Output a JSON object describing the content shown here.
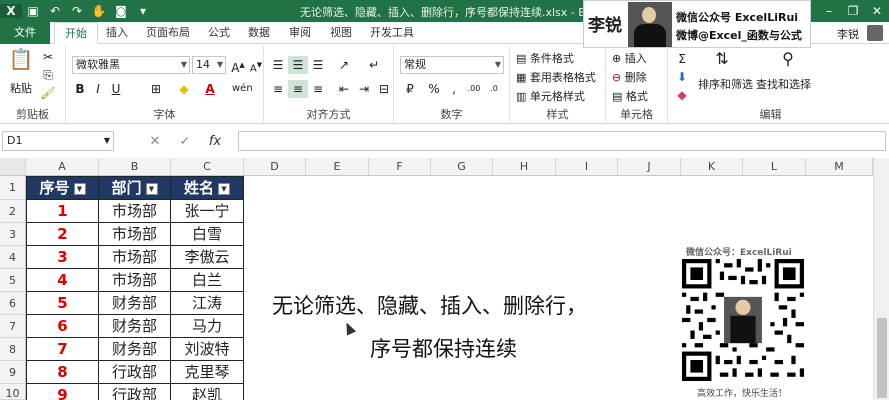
{
  "window": {
    "title": "无论筛选、隐藏、插入、删除行，序号都保持连续.xlsx - Excel"
  },
  "banner": {
    "name": "李锐",
    "line1": "微信公众号 ExcelLiRui",
    "line2": "微博@Excel_函数与公式"
  },
  "tabs": [
    "文件",
    "开始",
    "插入",
    "页面布局",
    "公式",
    "数据",
    "审阅",
    "视图",
    "开发工具"
  ],
  "user": "李锐",
  "ribbon": {
    "clipboard": {
      "label": "剪贴板",
      "paste": "粘贴"
    },
    "font": {
      "label": "字体",
      "name": "微软雅黑",
      "size": "14",
      "bold": "B",
      "italic": "I",
      "underline": "U"
    },
    "alignment": {
      "label": "对齐方式"
    },
    "number": {
      "label": "数字",
      "format": "常规"
    },
    "styles": {
      "label": "样式",
      "cond": "条件格式",
      "table": "套用表格格式",
      "cell": "单元格样式"
    },
    "cells": {
      "label": "单元格",
      "insert": "插入",
      "delete": "删除",
      "format": "格式"
    },
    "editing": {
      "label": "编辑",
      "sort": "排序和筛选",
      "find": "查找和选择"
    }
  },
  "formula_bar": {
    "name_box": "D1",
    "cancel": "✕",
    "enter": "✓",
    "fx": "fx",
    "value": ""
  },
  "columns": [
    "A",
    "B",
    "C",
    "D",
    "E",
    "F",
    "G",
    "H",
    "I",
    "J",
    "K",
    "L",
    "M"
  ],
  "rows": [
    "1",
    "2",
    "3",
    "4",
    "5",
    "6",
    "7",
    "8",
    "9",
    "10"
  ],
  "table": {
    "headers": [
      "序号",
      "部门",
      "姓名"
    ],
    "rows": [
      [
        "1",
        "市场部",
        "张一宁"
      ],
      [
        "2",
        "市场部",
        "白雪"
      ],
      [
        "3",
        "市场部",
        "李傲云"
      ],
      [
        "4",
        "市场部",
        "白兰"
      ],
      [
        "5",
        "财务部",
        "江涛"
      ],
      [
        "6",
        "财务部",
        "马力"
      ],
      [
        "7",
        "财务部",
        "刘波特"
      ],
      [
        "8",
        "行政部",
        "克里琴"
      ],
      [
        "9",
        "行政部",
        "赵凯"
      ]
    ]
  },
  "overlay": {
    "line1": "无论筛选、隐藏、插入、删除行，",
    "line2": "序号都保持连续",
    "qr_top": "微信公众号：ExcelLiRui",
    "qr_bottom": "高效工作，快乐生活！"
  }
}
